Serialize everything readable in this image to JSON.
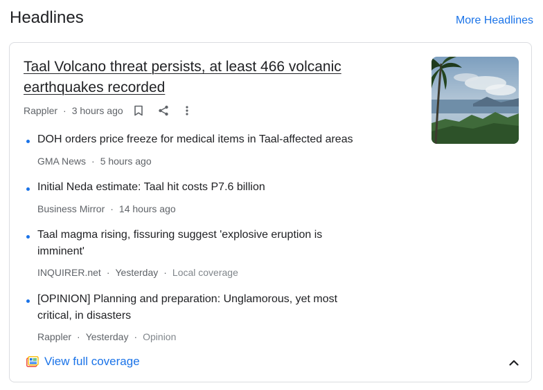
{
  "header": {
    "title": "Headlines",
    "more_link": "More Headlines"
  },
  "main_story": {
    "title": "Taal Volcano threat persists, at least 466 volcanic earthquakes recorded",
    "source": "Rappler",
    "time": "3 hours ago",
    "icons": [
      "bookmark-icon",
      "share-icon",
      "more-vert-icon"
    ],
    "thumbnail": "volcano-landscape-image"
  },
  "stories": [
    {
      "title": "DOH orders price freeze for medical items in Taal-affected areas",
      "source": "GMA News",
      "time": "5 hours ago",
      "tag": ""
    },
    {
      "title": "Initial Neda estimate: Taal hit costs P7.6 billion",
      "source": "Business Mirror",
      "time": "14 hours ago",
      "tag": ""
    },
    {
      "title": "Taal magma rising, fissuring suggest 'explosive eruption is imminent'",
      "source": "INQUIRER.net",
      "time": "Yesterday",
      "tag": "Local coverage"
    },
    {
      "title": "[OPINION] Planning and preparation: Unglamorous, yet most critical, in disasters",
      "source": "Rappler",
      "time": "Yesterday",
      "tag": "Opinion"
    }
  ],
  "coverage": {
    "label": "View full coverage",
    "icon": "full-coverage-icon"
  },
  "colors": {
    "accent": "#1a73e8",
    "text": "#202124",
    "secondary": "#5f6368",
    "border": "#dadce0"
  }
}
